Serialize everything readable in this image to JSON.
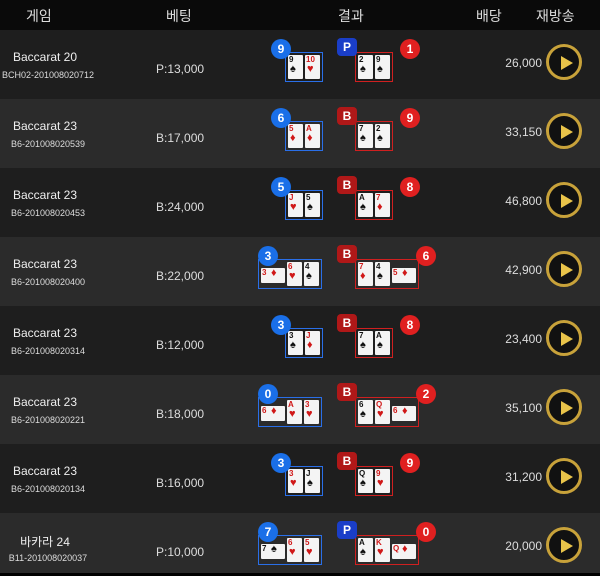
{
  "header": {
    "game": "게임",
    "bet": "베팅",
    "result": "결과",
    "payout": "배당",
    "replay": "재방송"
  },
  "rows": [
    {
      "name": "Baccarat 20",
      "id": "BCH02-201008020712",
      "bet": "P:13,000",
      "player_score": "9",
      "banker_score": "1",
      "winner": "P",
      "player_cards": [
        {
          "r": "9",
          "s": "♠",
          "c": "black"
        },
        {
          "r": "10",
          "s": "♥",
          "c": "red"
        }
      ],
      "banker_cards": [
        {
          "r": "2",
          "s": "♠",
          "c": "black"
        },
        {
          "r": "9",
          "s": "♠",
          "c": "black"
        }
      ],
      "payout": "26,000"
    },
    {
      "name": "Baccarat 23",
      "id": "B6-201008020539",
      "bet": "B:17,000",
      "player_score": "6",
      "banker_score": "9",
      "winner": "B",
      "player_cards": [
        {
          "r": "5",
          "s": "♦",
          "c": "red"
        },
        {
          "r": "A",
          "s": "♦",
          "c": "red"
        }
      ],
      "banker_cards": [
        {
          "r": "7",
          "s": "♠",
          "c": "black"
        },
        {
          "r": "2",
          "s": "♠",
          "c": "black"
        }
      ],
      "payout": "33,150"
    },
    {
      "name": "Baccarat 23",
      "id": "B6-201008020453",
      "bet": "B:24,000",
      "player_score": "5",
      "banker_score": "8",
      "winner": "B",
      "player_cards": [
        {
          "r": "J",
          "s": "♥",
          "c": "red"
        },
        {
          "r": "5",
          "s": "♠",
          "c": "black"
        }
      ],
      "banker_cards": [
        {
          "r": "A",
          "s": "♠",
          "c": "black"
        },
        {
          "r": "7",
          "s": "♦",
          "c": "red"
        }
      ],
      "payout": "46,800"
    },
    {
      "name": "Baccarat 23",
      "id": "B6-201008020400",
      "bet": "B:22,000",
      "player_score": "3",
      "banker_score": "6",
      "winner": "B",
      "player_side": {
        "r": "3",
        "s": "♦",
        "c": "red"
      },
      "player_cards": [
        {
          "r": "6",
          "s": "♥",
          "c": "red"
        },
        {
          "r": "4",
          "s": "♠",
          "c": "black"
        }
      ],
      "banker_cards": [
        {
          "r": "7",
          "s": "♦",
          "c": "red"
        },
        {
          "r": "4",
          "s": "♠",
          "c": "black"
        }
      ],
      "banker_side": {
        "r": "5",
        "s": "♦",
        "c": "red"
      },
      "payout": "42,900"
    },
    {
      "name": "Baccarat 23",
      "id": "B6-201008020314",
      "bet": "B:12,000",
      "player_score": "3",
      "banker_score": "8",
      "winner": "B",
      "player_cards": [
        {
          "r": "3",
          "s": "♠",
          "c": "black"
        },
        {
          "r": "J",
          "s": "♦",
          "c": "red"
        }
      ],
      "banker_cards": [
        {
          "r": "7",
          "s": "♠",
          "c": "black"
        },
        {
          "r": "A",
          "s": "♠",
          "c": "black"
        }
      ],
      "payout": "23,400"
    },
    {
      "name": "Baccarat 23",
      "id": "B6-201008020221",
      "bet": "B:18,000",
      "player_score": "0",
      "banker_score": "2",
      "winner": "B",
      "player_side": {
        "r": "6",
        "s": "♦",
        "c": "red"
      },
      "player_cards": [
        {
          "r": "A",
          "s": "♥",
          "c": "red"
        },
        {
          "r": "3",
          "s": "♥",
          "c": "red"
        }
      ],
      "banker_cards": [
        {
          "r": "6",
          "s": "♠",
          "c": "black"
        },
        {
          "r": "Q",
          "s": "♥",
          "c": "red"
        }
      ],
      "banker_side": {
        "r": "6",
        "s": "♦",
        "c": "red"
      },
      "payout": "35,100"
    },
    {
      "name": "Baccarat 23",
      "id": "B6-201008020134",
      "bet": "B:16,000",
      "player_score": "3",
      "banker_score": "9",
      "winner": "B",
      "player_cards": [
        {
          "r": "3",
          "s": "♥",
          "c": "red"
        },
        {
          "r": "J",
          "s": "♠",
          "c": "black"
        }
      ],
      "banker_cards": [
        {
          "r": "Q",
          "s": "♠",
          "c": "black"
        },
        {
          "r": "9",
          "s": "♥",
          "c": "red"
        }
      ],
      "payout": "31,200"
    },
    {
      "name": "바카라 24",
      "id": "B11-201008020037",
      "bet": "P:10,000",
      "player_score": "7",
      "banker_score": "0",
      "winner": "P",
      "player_side": {
        "r": "7",
        "s": "♠",
        "c": "black"
      },
      "player_cards": [
        {
          "r": "6",
          "s": "♥",
          "c": "red"
        },
        {
          "r": "5",
          "s": "♥",
          "c": "red"
        }
      ],
      "banker_cards": [
        {
          "r": "A",
          "s": "♠",
          "c": "black"
        },
        {
          "r": "K",
          "s": "♥",
          "c": "red"
        }
      ],
      "banker_side": {
        "r": "Q",
        "s": "♦",
        "c": "red"
      },
      "payout": "20,000"
    }
  ]
}
